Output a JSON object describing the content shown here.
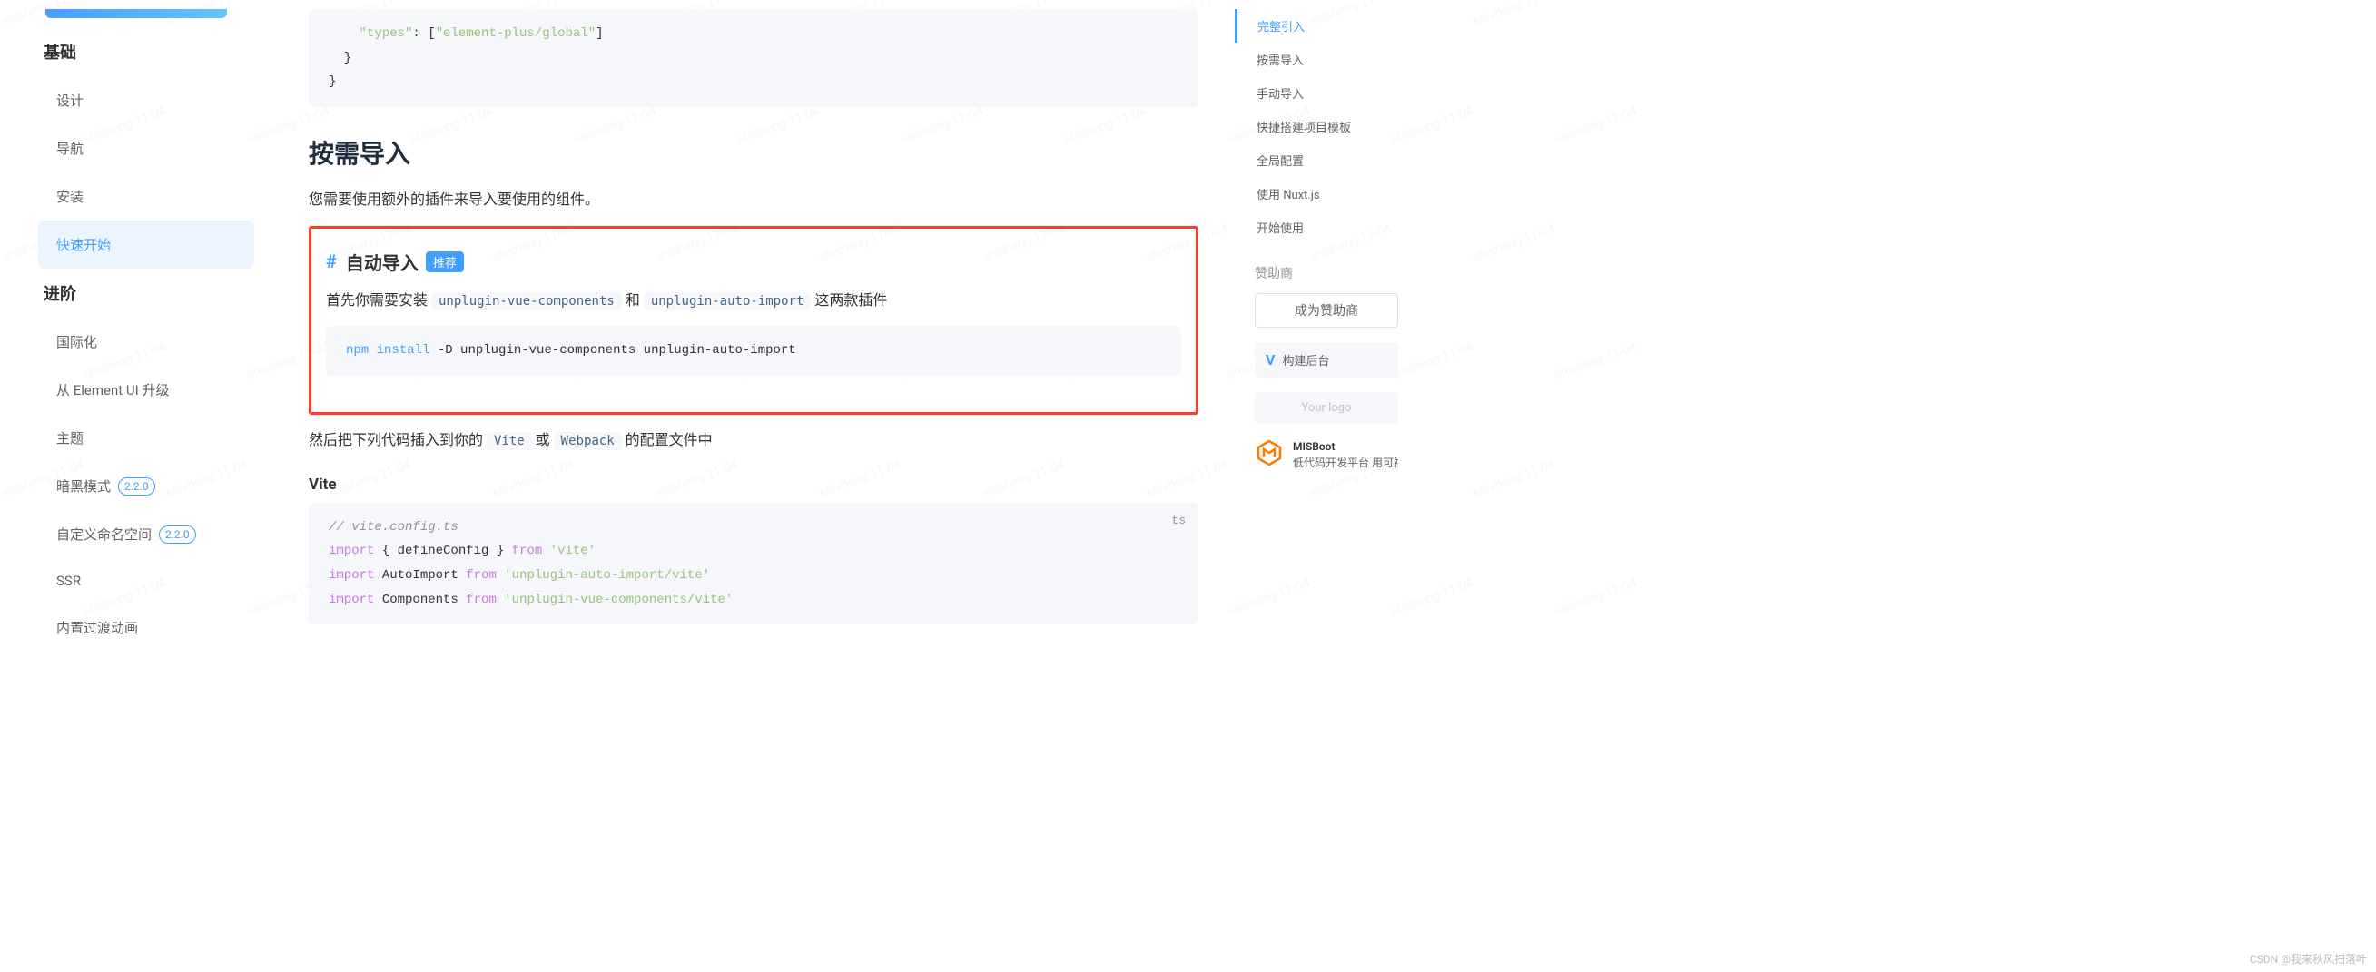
{
  "watermark": "shisheng 11-04",
  "sidebar": {
    "groups": [
      {
        "title": "基础",
        "items": [
          {
            "label": "设计",
            "active": false
          },
          {
            "label": "导航",
            "active": false
          },
          {
            "label": "安装",
            "active": false
          },
          {
            "label": "快速开始",
            "active": true
          }
        ]
      },
      {
        "title": "进阶",
        "items": [
          {
            "label": "国际化",
            "active": false
          },
          {
            "label": "从 Element UI 升级",
            "active": false
          },
          {
            "label": "主题",
            "active": false
          },
          {
            "label": "暗黑模式",
            "active": false,
            "version": "2.2.0"
          },
          {
            "label": "自定义命名空间",
            "active": false,
            "version": "2.2.0"
          },
          {
            "label": "SSR",
            "active": false
          },
          {
            "label": "内置过渡动画",
            "active": false
          }
        ]
      }
    ]
  },
  "main": {
    "code1": {
      "line1_key": "\"types\"",
      "line1_mid": ": [",
      "line1_val": "\"element-plus/global\"",
      "line1_end": "]",
      "brace1": "  }",
      "brace2": "}"
    },
    "section_ondemand": "按需导入",
    "ondemand_desc": "您需要使用额外的插件来导入要使用的组件。",
    "hash": "#",
    "subsection_auto": "自动导入",
    "tag_recommended": "推荐",
    "auto_desc_1": "首先你需要安装 ",
    "pkg1": "unplugin-vue-components",
    "auto_desc_2": " 和 ",
    "pkg2": "unplugin-auto-import",
    "auto_desc_3": " 这两款插件",
    "npm_cmd": {
      "w1": "npm",
      "w2": "install",
      "rest": " -D unplugin-vue-components unplugin-auto-import"
    },
    "then_desc_1": "然后把下列代码插入到你的 ",
    "vite": "Vite",
    "then_desc_2": " 或 ",
    "webpack": "Webpack",
    "then_desc_3": " 的配置文件中",
    "vite_heading": "Vite",
    "code2_lang": "ts",
    "code2": {
      "c1": "// vite.config.ts",
      "l2_a": "import",
      "l2_b": " { defineConfig } ",
      "l2_c": "from",
      "l2_d": " 'vite'",
      "l3_a": "import",
      "l3_b": " AutoImport ",
      "l3_c": "from",
      "l3_d": " 'unplugin-auto-import/vite'",
      "l4_a": "import",
      "l4_b": " Components ",
      "l4_c": "from",
      "l4_d": " 'unplugin-vue-components/vite'"
    }
  },
  "toc": {
    "items": [
      {
        "label": "完整引入",
        "active": true
      },
      {
        "label": "按需导入",
        "active": false
      },
      {
        "label": "手动导入",
        "active": false
      },
      {
        "label": "快捷搭建项目模板",
        "active": false
      },
      {
        "label": "全局配置",
        "active": false
      },
      {
        "label": "使用 Nuxt.js",
        "active": false
      },
      {
        "label": "开始使用",
        "active": false
      }
    ],
    "sponsor_title": "赞助商",
    "become_sponsor": "成为赞助商",
    "build_backend": "构建后台",
    "your_logo": "Your logo",
    "mis_title": "MISBoot",
    "mis_desc": "低代码开发平台 用可视化"
  },
  "attribution": "CSDN @我来秋风扫落叶"
}
